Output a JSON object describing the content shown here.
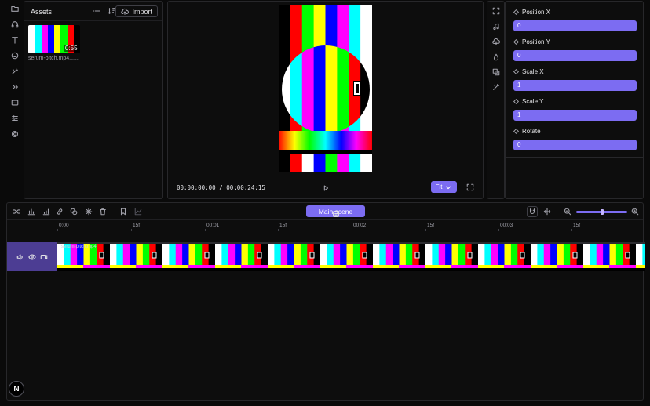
{
  "colors": {
    "accent": "#7c6cf2",
    "track_header": "#4c3d93",
    "bars": [
      "#ffffff",
      "#ffff00",
      "#00ffff",
      "#00ff00",
      "#ff00ff",
      "#ff0000",
      "#0000ff",
      "#000000"
    ]
  },
  "left_rail": {
    "icons": [
      "folder-icon",
      "headphones-icon",
      "text-icon",
      "smiley-icon",
      "magic-wand-icon",
      "chevrons-right-icon",
      "subtitles-icon",
      "sliders-icon",
      "settings-icon"
    ]
  },
  "assets": {
    "title": "Assets",
    "import_label": "Import",
    "items": [
      {
        "name": "serum-pitch.mp4......",
        "duration": "0:55"
      }
    ]
  },
  "preview": {
    "timecode": "00:00:00:00 / 00:00:24:15",
    "fit_label": "Fit"
  },
  "right_rail": {
    "icons": [
      "expand-icon",
      "music-icon",
      "download-icon",
      "drop-icon",
      "layers-icon",
      "magic-wand-icon"
    ]
  },
  "properties": [
    {
      "label": "Position X",
      "value": "0"
    },
    {
      "label": "Position Y",
      "value": "0"
    },
    {
      "label": "Scale X",
      "value": "1"
    },
    {
      "label": "Scale Y",
      "value": "1"
    },
    {
      "label": "Rotate",
      "value": "0"
    }
  ],
  "timeline": {
    "scene_label": "Main scene",
    "ruler": [
      "0:00",
      "15f",
      "00:01",
      "15f",
      "00:02",
      "15f",
      "00:03",
      "15f"
    ],
    "clip_label": "serum-pitch.mp4",
    "zoom_level": 0.45
  },
  "logo_letter": "N"
}
